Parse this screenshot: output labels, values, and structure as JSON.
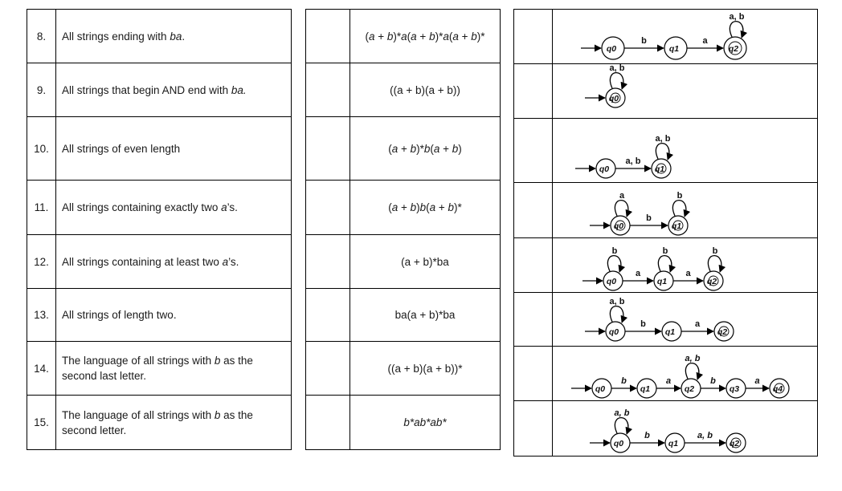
{
  "rows": [
    {
      "num": "8.",
      "desc_parts": [
        {
          "t": "All strings ending with "
        },
        {
          "t": "ba",
          "i": true
        },
        {
          "t": "."
        }
      ],
      "regex_parts": [
        {
          "t": "(",
          "i": false
        },
        {
          "t": "a",
          "i": true
        },
        {
          "t": " + "
        },
        {
          "t": "b",
          "i": true
        },
        {
          "t": ")*"
        },
        {
          "t": "a",
          "i": true
        },
        {
          "t": "("
        },
        {
          "t": "a",
          "i": true
        },
        {
          "t": " + "
        },
        {
          "t": "b",
          "i": true
        },
        {
          "t": ")*"
        },
        {
          "t": "a",
          "i": true
        },
        {
          "t": "("
        },
        {
          "t": "a",
          "i": true
        },
        {
          "t": " + "
        },
        {
          "t": "b",
          "i": true
        },
        {
          "t": ")*"
        }
      ]
    },
    {
      "num": "9.",
      "desc_parts": [
        {
          "t": "All strings that begin AND end with "
        },
        {
          "t": "ba.",
          "i": true
        }
      ],
      "regex_parts": [
        {
          "t": "((a + b)(a + b))"
        }
      ]
    },
    {
      "num": "10.",
      "desc_parts": [
        {
          "t": "All strings of even length"
        }
      ],
      "regex_parts": [
        {
          "t": "("
        },
        {
          "t": "a",
          "i": true
        },
        {
          "t": " + "
        },
        {
          "t": "b",
          "i": true
        },
        {
          "t": ")*"
        },
        {
          "t": "b",
          "i": true
        },
        {
          "t": "("
        },
        {
          "t": "a",
          "i": true
        },
        {
          "t": " + "
        },
        {
          "t": "b",
          "i": true
        },
        {
          "t": ")"
        }
      ]
    },
    {
      "num": "11.",
      "desc_parts": [
        {
          "t": "All strings containing exactly two "
        },
        {
          "t": "a",
          "i": true
        },
        {
          "t": "’s."
        }
      ],
      "regex_parts": [
        {
          "t": "("
        },
        {
          "t": "a",
          "i": true
        },
        {
          "t": " + "
        },
        {
          "t": "b",
          "i": true
        },
        {
          "t": ")"
        },
        {
          "t": "b",
          "i": true
        },
        {
          "t": "("
        },
        {
          "t": "a",
          "i": true
        },
        {
          "t": " + "
        },
        {
          "t": "b",
          "i": true
        },
        {
          "t": ")*"
        }
      ]
    },
    {
      "num": "12.",
      "desc_parts": [
        {
          "t": "All strings containing at least two "
        },
        {
          "t": "a",
          "i": true
        },
        {
          "t": "’s."
        }
      ],
      "regex_parts": [
        {
          "t": "(a + b)*ba"
        }
      ]
    },
    {
      "num": "13.",
      "desc_parts": [
        {
          "t": "All strings of length two."
        }
      ],
      "regex_parts": [
        {
          "t": "ba(a + b)*ba"
        }
      ]
    },
    {
      "num": "14.",
      "desc_parts": [
        {
          "t": "The language of all strings with "
        },
        {
          "t": "b",
          "i": true
        },
        {
          "t": " as the second last letter."
        }
      ],
      "regex_parts": [
        {
          "t": "((a + b)(a + b))*"
        }
      ]
    },
    {
      "num": "15.",
      "desc_parts": [
        {
          "t": "The language of all strings with "
        },
        {
          "t": "b",
          "i": true
        },
        {
          "t": " as the second letter."
        }
      ],
      "regex_parts": [
        {
          "t": "b*ab*ab*",
          "i": true
        }
      ]
    }
  ],
  "diagrams": [
    {
      "states": [
        "q0",
        "q1",
        "q2"
      ],
      "accepting": [
        2
      ],
      "start": 0,
      "edges": [
        {
          "from": 0,
          "to": 1,
          "label": "b"
        },
        {
          "from": 1,
          "to": 2,
          "label": "a"
        }
      ],
      "loops": [
        {
          "state": 2,
          "label": "a, b"
        }
      ]
    },
    {
      "states": [
        "q0"
      ],
      "accepting": [
        0
      ],
      "start": 0,
      "edges": [],
      "loops": [
        {
          "state": 0,
          "label": "a, b"
        }
      ]
    },
    {
      "states": [
        "q0",
        "q1"
      ],
      "accepting": [
        1
      ],
      "start": 0,
      "edges": [
        {
          "from": 0,
          "to": 1,
          "label": "a, b"
        }
      ],
      "loops": [
        {
          "state": 1,
          "label": "a, b"
        }
      ]
    },
    {
      "states": [
        "q0",
        "q1"
      ],
      "accepting": [
        0,
        1
      ],
      "start": 0,
      "edges": [
        {
          "from": 0,
          "to": 1,
          "label": "b"
        }
      ],
      "loops": [
        {
          "state": 0,
          "label": "a"
        },
        {
          "state": 1,
          "label": "b"
        }
      ]
    },
    {
      "states": [
        "q0",
        "q1",
        "q2"
      ],
      "accepting": [
        2
      ],
      "start": 0,
      "edges": [
        {
          "from": 0,
          "to": 1,
          "label": "a"
        },
        {
          "from": 1,
          "to": 2,
          "label": "a"
        }
      ],
      "loops": [
        {
          "state": 0,
          "label": "b"
        },
        {
          "state": 1,
          "label": "b"
        },
        {
          "state": 2,
          "label": "b"
        }
      ]
    },
    {
      "states": [
        "q0",
        "q1",
        "q2"
      ],
      "accepting": [
        2
      ],
      "start": 0,
      "edges": [
        {
          "from": 0,
          "to": 1,
          "label": "b"
        },
        {
          "from": 1,
          "to": 2,
          "label": "a"
        }
      ],
      "loops": [
        {
          "state": 0,
          "label": "a, b"
        }
      ]
    },
    {
      "states": [
        "q0",
        "q1",
        "q2",
        "q3",
        "q4"
      ],
      "accepting": [
        4
      ],
      "start": 0,
      "edges": [
        {
          "from": 0,
          "to": 1,
          "label": "b"
        },
        {
          "from": 1,
          "to": 2,
          "label": "a"
        },
        {
          "from": 2,
          "to": 3,
          "label": "b"
        },
        {
          "from": 3,
          "to": 4,
          "label": "a"
        }
      ],
      "loops": [
        {
          "state": 2,
          "label": "a, b"
        }
      ]
    },
    {
      "states": [
        "q0",
        "q1",
        "q2"
      ],
      "accepting": [
        2
      ],
      "start": 0,
      "edges": [
        {
          "from": 0,
          "to": 1,
          "label": "b"
        },
        {
          "from": 1,
          "to": 2,
          "label": "a, b"
        }
      ],
      "loops": [
        {
          "state": 0,
          "label": "a, b"
        }
      ]
    }
  ]
}
